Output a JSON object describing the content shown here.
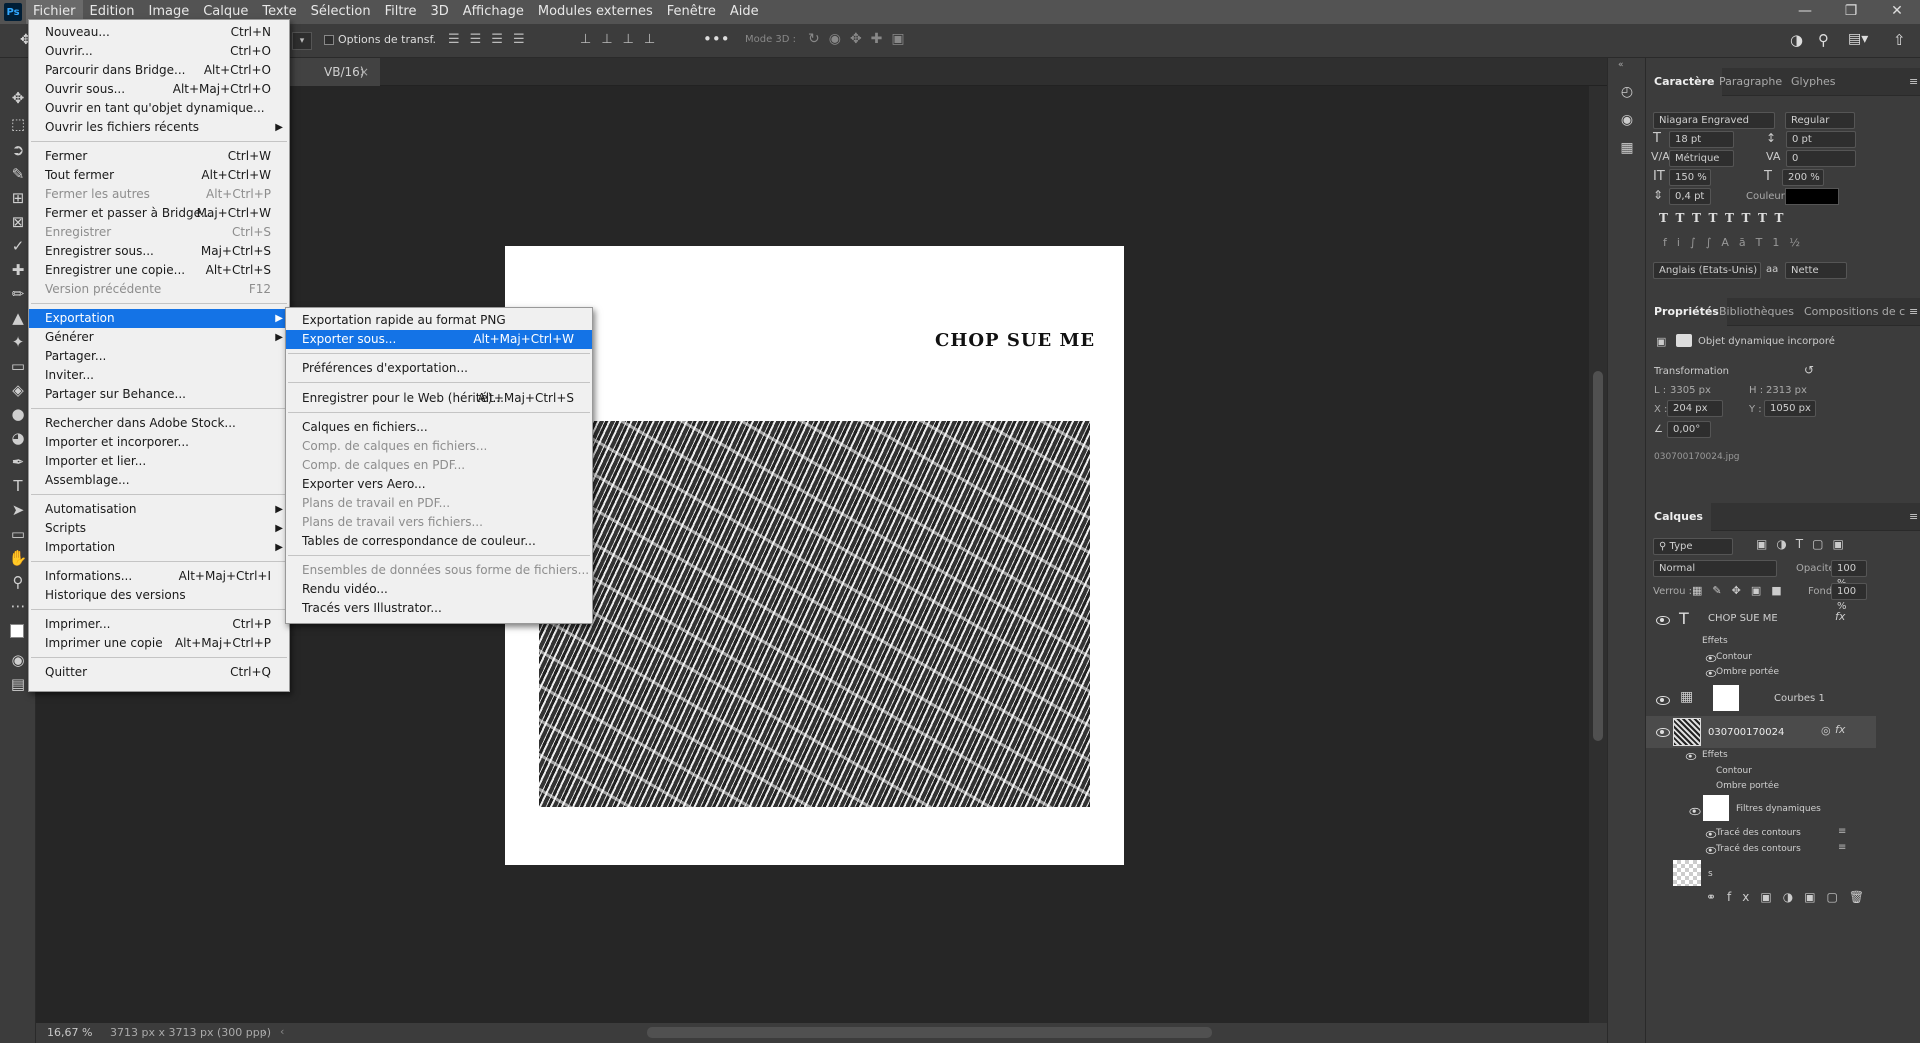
{
  "menubar": {
    "app_icon": "Ps",
    "items": [
      "Fichier",
      "Edition",
      "Image",
      "Calque",
      "Texte",
      "Sélection",
      "Filtre",
      "3D",
      "Affichage",
      "Modules externes",
      "Fenêtre",
      "Aide"
    ]
  },
  "options_bar": {
    "transform_options": "Options de transf.",
    "mode3d": "Mode 3D :"
  },
  "document": {
    "tab_title": "VB/16)",
    "canvas_text": "CHOP SUE ME"
  },
  "status": {
    "zoom": "16,67 %",
    "size": "3713 px x 3713 px (300 ppp)"
  },
  "file_menu": [
    {
      "label": "Nouveau...",
      "key": "Ctrl+N"
    },
    {
      "label": "Ouvrir...",
      "key": "Ctrl+O"
    },
    {
      "label": "Parcourir dans Bridge...",
      "key": "Alt+Ctrl+O"
    },
    {
      "label": "Ouvrir sous...",
      "key": "Alt+Maj+Ctrl+O"
    },
    {
      "label": "Ouvrir en tant qu'objet dynamique...",
      "key": ""
    },
    {
      "label": "Ouvrir les fichiers récents",
      "key": ""
    },
    {
      "label": "Fermer",
      "key": "Ctrl+W"
    },
    {
      "label": "Tout fermer",
      "key": "Alt+Ctrl+W"
    },
    {
      "label": "Fermer les autres",
      "key": "Alt+Ctrl+P"
    },
    {
      "label": "Fermer et passer à Bridge...",
      "key": "Maj+Ctrl+W"
    },
    {
      "label": "Enregistrer",
      "key": "Ctrl+S"
    },
    {
      "label": "Enregistrer sous...",
      "key": "Maj+Ctrl+S"
    },
    {
      "label": "Enregistrer une copie...",
      "key": "Alt+Ctrl+S"
    },
    {
      "label": "Version précédente",
      "key": "F12"
    },
    {
      "label": "Exportation",
      "key": ""
    },
    {
      "label": "Générer",
      "key": ""
    },
    {
      "label": "Partager...",
      "key": ""
    },
    {
      "label": "Inviter...",
      "key": ""
    },
    {
      "label": "Partager sur Behance...",
      "key": ""
    },
    {
      "label": "Rechercher dans Adobe Stock...",
      "key": ""
    },
    {
      "label": "Importer et incorporer...",
      "key": ""
    },
    {
      "label": "Importer et lier...",
      "key": ""
    },
    {
      "label": "Assemblage...",
      "key": ""
    },
    {
      "label": "Automatisation",
      "key": ""
    },
    {
      "label": "Scripts",
      "key": ""
    },
    {
      "label": "Importation",
      "key": ""
    },
    {
      "label": "Informations...",
      "key": "Alt+Maj+Ctrl+I"
    },
    {
      "label": "Historique des versions",
      "key": ""
    },
    {
      "label": "Imprimer...",
      "key": "Ctrl+P"
    },
    {
      "label": "Imprimer une copie",
      "key": "Alt+Maj+Ctrl+P"
    },
    {
      "label": "Quitter",
      "key": "Ctrl+Q"
    }
  ],
  "export_menu": [
    {
      "label": "Exportation rapide au format PNG",
      "key": ""
    },
    {
      "label": "Exporter sous...",
      "key": "Alt+Maj+Ctrl+W"
    },
    {
      "label": "Préférences d'exportation...",
      "key": ""
    },
    {
      "label": "Enregistrer pour le Web (hérité)...",
      "key": "Alt+Maj+Ctrl+S"
    },
    {
      "label": "Calques en fichiers...",
      "key": ""
    },
    {
      "label": "Comp. de calques en fichiers...",
      "key": ""
    },
    {
      "label": "Comp. de calques en PDF...",
      "key": ""
    },
    {
      "label": "Exporter vers Aero...",
      "key": ""
    },
    {
      "label": "Plans de travail en PDF...",
      "key": ""
    },
    {
      "label": "Plans de travail vers fichiers...",
      "key": ""
    },
    {
      "label": "Tables de correspondance de couleur...",
      "key": ""
    },
    {
      "label": "Ensembles de données sous forme de fichiers...",
      "key": ""
    },
    {
      "label": "Rendu vidéo...",
      "key": ""
    },
    {
      "label": "Tracés vers Illustrator...",
      "key": ""
    }
  ],
  "character_panel": {
    "tabs": [
      "Caractère",
      "Paragraphe",
      "Glyphes"
    ],
    "font": "Niagara Engraved",
    "style": "Regular",
    "size": "18 pt",
    "leading": "0 pt",
    "kerning": "Métrique",
    "tracking": "0",
    "vscale": "150 %",
    "hscale": "200 %",
    "baseline": "0,4 pt",
    "color_label": "Couleur :",
    "color": "#000000",
    "language": "Anglais (Etats-Unis)",
    "antialias": "Nette"
  },
  "properties_panel": {
    "tabs": [
      "Propriétés",
      "Bibliothèques",
      "Compositions de c"
    ],
    "type": "Objet dynamique incorporé",
    "section": "Transformation",
    "L": "3305 px",
    "H": "2313 px",
    "X": "204 px",
    "Y": "1050 px",
    "angle": "0,00°",
    "filename": "030700170024.jpg",
    "lbl_L": "L :",
    "lbl_H": "H :",
    "lbl_X": "X :",
    "lbl_Y": "Y :"
  },
  "layers_panel": {
    "title": "Calques",
    "filter": "Type",
    "blend": "Normal",
    "opacity_label": "Opacité :",
    "opacity": "100 %",
    "lock_label": "Verrou :",
    "fill_label": "Fond :",
    "fill": "100 %",
    "layers": {
      "text_layer": "CHOP SUE ME",
      "effects": "Effets",
      "contour": "Contour",
      "shadow": "Ombre portée",
      "curves": "Courbes 1",
      "smart": "030700170024",
      "effects2": "Effets",
      "contour2": "Contour",
      "shadow2": "Ombre portée",
      "smart_filters": "Filtres dynamiques",
      "trace1": "Tracé des contours",
      "trace2": "Tracé des contours",
      "bottom": "s"
    }
  }
}
